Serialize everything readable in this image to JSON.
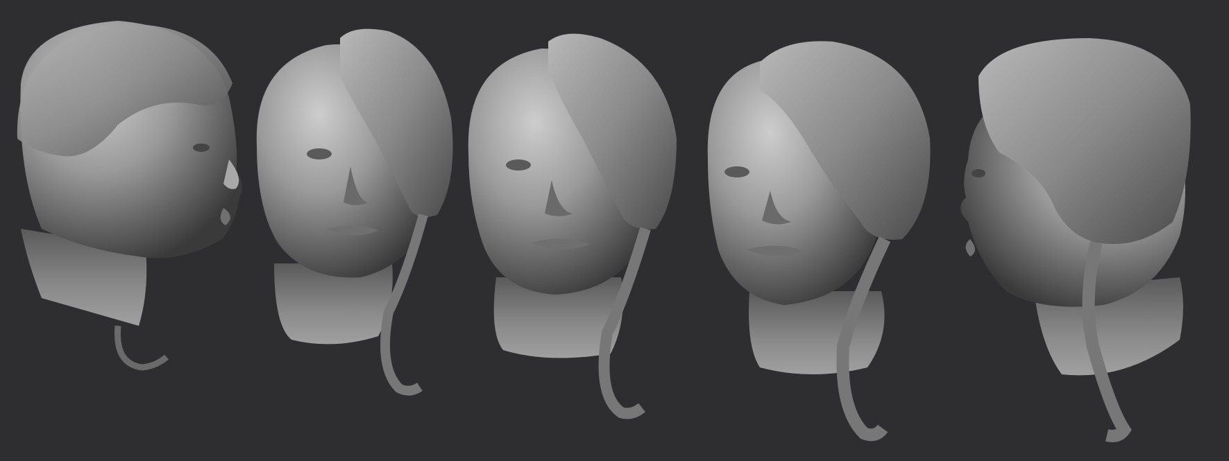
{
  "scene": {
    "background": "#2e2e30",
    "clay_light": "#c9c9c9",
    "clay_mid": "#8e8e8e",
    "clay_dark": "#3a3a3a",
    "views": [
      {
        "name": "right-profile",
        "facing": "right",
        "hair_coverage": 0.0
      },
      {
        "name": "three-quarter-left",
        "facing": "slight-left",
        "hair_coverage": 0.5
      },
      {
        "name": "front",
        "facing": "front",
        "hair_coverage": 0.5
      },
      {
        "name": "three-quarter-right",
        "facing": "slight-right",
        "hair_coverage": 0.55
      },
      {
        "name": "left-profile",
        "facing": "left",
        "hair_coverage": 0.7
      }
    ]
  }
}
